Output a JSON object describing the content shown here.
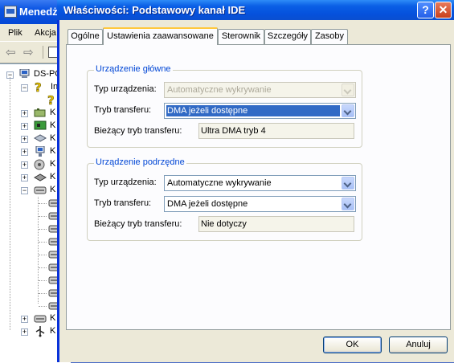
{
  "background_window": {
    "title": "Menedż",
    "menu": [
      "Plik",
      "Akcja"
    ],
    "tree_root": "DS-PC",
    "tree_item_visible": "In",
    "tree_item_prefix": "K"
  },
  "dialog": {
    "title": "Właściwości: Podstawowy kanał IDE",
    "help_glyph": "?",
    "close_glyph": "✕",
    "tabs": [
      {
        "label": "Ogólne",
        "active": false
      },
      {
        "label": "Ustawienia zaawansowane",
        "active": true
      },
      {
        "label": "Sterownik",
        "active": false
      },
      {
        "label": "Szczegóły",
        "active": false
      },
      {
        "label": "Zasoby",
        "active": false
      }
    ],
    "groups": [
      {
        "title": "Urządzenie główne",
        "device_type_label": "Typ urządzenia:",
        "device_type_value": "Automatyczne wykrywanie",
        "device_type_enabled": false,
        "transfer_mode_label": "Tryb transferu:",
        "transfer_mode_value": "DMA jeżeli dostępne",
        "current_mode_label": "Bieżący tryb transferu:",
        "current_mode_value": "Ultra DMA tryb 4"
      },
      {
        "title": "Urządzenie podrzędne",
        "device_type_label": "Typ urządzenia:",
        "device_type_value": "Automatyczne wykrywanie",
        "device_type_enabled": true,
        "transfer_mode_label": "Tryb transferu:",
        "transfer_mode_value": "DMA jeżeli dostępne",
        "current_mode_label": "Bieżący tryb transferu:",
        "current_mode_value": "Nie dotyczy"
      }
    ],
    "buttons": {
      "ok": "OK",
      "cancel": "Anuluj"
    }
  },
  "colors": {
    "titlebar_blue": "#0a5fe6",
    "group_title": "#0046d5",
    "selection": "#316ac5",
    "active_tab_accent": "#ffc83c"
  }
}
